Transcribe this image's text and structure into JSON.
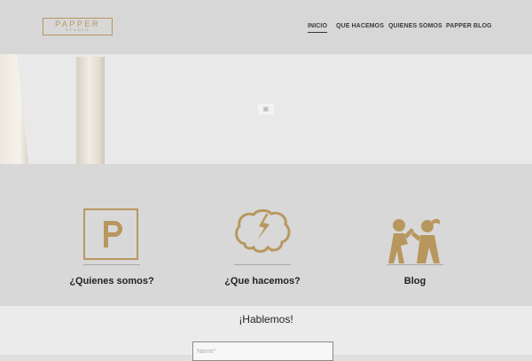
{
  "brand": {
    "logo_main": "PAPPER",
    "logo_sub": "STUDIO",
    "color": "#b8975f"
  },
  "nav": {
    "items": [
      {
        "label": "INICIO",
        "active": true
      },
      {
        "label": "QUE HACEMOS",
        "active": false
      },
      {
        "label": "QUIENES SOMOS",
        "active": false
      },
      {
        "label": "PAPPER BLOG",
        "active": false
      }
    ]
  },
  "hero": {
    "icon": "image-icon"
  },
  "features": [
    {
      "title": "¿Quienes somos?",
      "icon": "letter-p-icon"
    },
    {
      "title": "¿Que hacemos?",
      "icon": "brain-icon"
    },
    {
      "title": "Blog",
      "icon": "people-talking-icon"
    }
  ],
  "contact": {
    "title": "¡Hablemos!",
    "name_placeholder": "Name*"
  }
}
